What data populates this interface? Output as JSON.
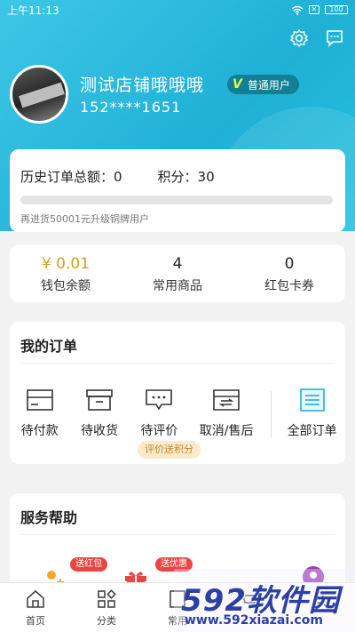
{
  "status_bar": {
    "time": "上午11:13",
    "battery": "100"
  },
  "profile": {
    "store_name": "测试店铺哦哦哦",
    "badge_label": "普通用户",
    "phone": "152****1651"
  },
  "history": {
    "total_label": "历史订单总额：0",
    "points_label": "积分：30",
    "hint": "再进货50001元升级铜牌用户",
    "progress": 0.0
  },
  "stats": [
    {
      "value": "¥ 0.01",
      "label": "钱包余额"
    },
    {
      "value": "4",
      "label": "常用商品"
    },
    {
      "value": "0",
      "label": "红包卡券"
    }
  ],
  "orders": {
    "title": "我的订单",
    "items": [
      {
        "label": "待付款",
        "icon": "wallet-icon"
      },
      {
        "label": "待收货",
        "icon": "box-icon"
      },
      {
        "label": "待评价",
        "icon": "comment-icon"
      },
      {
        "label": "取消/售后",
        "icon": "refund-icon"
      }
    ],
    "all_label": "全部订单",
    "review_tag": "评价送积分"
  },
  "help": {
    "title": "服务帮助",
    "tag1": "送红包",
    "tag2": "送优惠"
  },
  "tabbar": [
    {
      "label": "首页",
      "icon": "home-icon"
    },
    {
      "label": "分类",
      "icon": "category-icon"
    },
    {
      "label": "常用",
      "icon": "favorite-icon"
    },
    {
      "label": "",
      "icon": "cart-icon"
    },
    {
      "label": "",
      "icon": "profile-icon"
    }
  ],
  "watermark": {
    "logo": "592软件园",
    "url": "www.592xiazai.com"
  },
  "colors": {
    "accent": "#1fb0d6",
    "badge": "#147e93",
    "gold": "#d4a020",
    "tag_red": "#e84545"
  }
}
